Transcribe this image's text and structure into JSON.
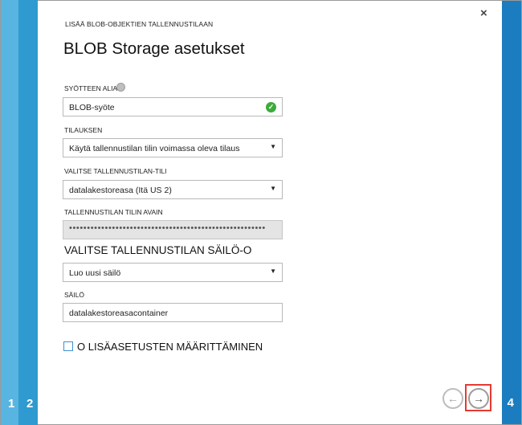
{
  "dialog": {
    "subtitle": "LISÄÄ BLOB-OBJEKTIEN TALLENNUSTILAAN",
    "title": "BLOB Storage asetukset"
  },
  "steps": {
    "first": "1",
    "second": "2",
    "current": "4"
  },
  "close_label": "×",
  "form": {
    "alias_label": "SYÖTTEEN ALIAS",
    "alias_value": "BLOB-syöte",
    "subscription_label": "TILAUKSEN",
    "subscription_value": "Käytä tallennustilan tilin voimassa oleva tilaus",
    "storage_account_label": "VALITSE TALLENNUSTILAN-TILI",
    "storage_account_value": "datalakestoreasa (Itä US 2)",
    "storage_key_label": "TALLENNUSTILAN TILIN AVAIN",
    "storage_key_value": "•••••••••••••••••••••••••••••••••••••••••••••••••••••••",
    "container_section_label": "VALITSE TALLENNUSTILAN SÄILÖ-O",
    "container_option_value": "Luo uusi säilö",
    "container_label": "SÄILÖ",
    "container_value": "datalakestoreasacontainer",
    "advanced_label": "O LISÄASETUSTEN MÄÄRITTÄMINEN"
  },
  "icons": {
    "dropdown": "▼",
    "valid": "✓",
    "back": "←",
    "next": "→"
  },
  "colors": {
    "step_strip_1": "#58b4e0",
    "step_strip_2": "#2e9ad0",
    "step_strip_current": "#1b7dbf",
    "valid_green": "#3cab3c",
    "highlight_red": "#e53a2f"
  }
}
